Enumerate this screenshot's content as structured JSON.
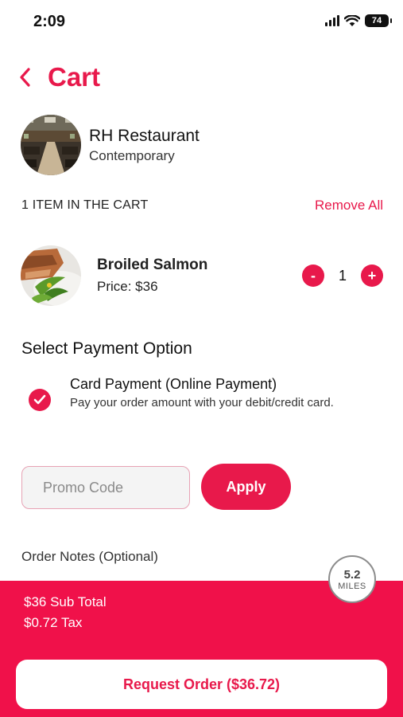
{
  "status_bar": {
    "time": "2:09",
    "battery": "74",
    "icons": [
      "signal-icon",
      "wifi-icon",
      "battery-icon"
    ]
  },
  "header": {
    "back_icon": "chevron-left-icon",
    "title": "Cart"
  },
  "restaurant": {
    "name": "RH Restaurant",
    "cuisine": "Contemporary"
  },
  "cart": {
    "count_label": "1 ITEM IN THE CART",
    "remove_all_label": "Remove All"
  },
  "items": [
    {
      "name": "Broiled Salmon",
      "price": "Price: $36",
      "quantity": "1",
      "minus": "-",
      "plus": "+"
    }
  ],
  "payment": {
    "section_title": "Select Payment Option",
    "options": [
      {
        "name": "Card Payment (Online Payment)",
        "description": "Pay your order amount with your debit/credit card.",
        "selected": true
      }
    ]
  },
  "promo": {
    "placeholder": "Promo Code",
    "value": "",
    "apply_label": "Apply"
  },
  "notes": {
    "label": "Order Notes (Optional)"
  },
  "summary": {
    "subtotal": "$36 Sub Total",
    "tax": "$0.72 Tax",
    "distance_value": "5.2",
    "distance_unit": "MILES",
    "request_label": "Request Order ($36.72)"
  },
  "colors": {
    "accent": "#e8194b",
    "summary_bg": "#f0114a",
    "promo_border": "#e7a2b4"
  }
}
